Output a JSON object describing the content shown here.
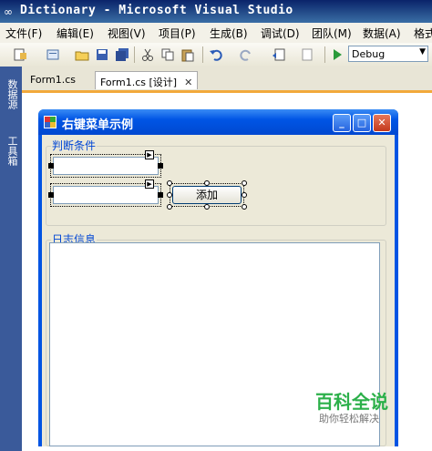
{
  "window": {
    "title": "Dictionary - Microsoft Visual Studio"
  },
  "menu": [
    "文件(F)",
    "编辑(E)",
    "视图(V)",
    "项目(P)",
    "生成(B)",
    "调试(D)",
    "团队(M)",
    "数据(A)",
    "格式"
  ],
  "toolbar": {
    "config_value": "Debug"
  },
  "side_tabs": [
    "数据源",
    "工具箱"
  ],
  "tabs": [
    {
      "label": "Form1.cs"
    },
    {
      "label": "Form1.cs [设计]",
      "close": "✕"
    }
  ],
  "form": {
    "title": "右键菜单示例",
    "group1_label": "判断条件",
    "add_button": "添加",
    "group2_label": "日志信息"
  },
  "watermark": {
    "line1": "百科全说",
    "line2": "助你轻松解决"
  },
  "colors": {
    "accent_tab": "#f2a93b",
    "xp_title": "#0054e3",
    "group_label": "#0046d5"
  }
}
